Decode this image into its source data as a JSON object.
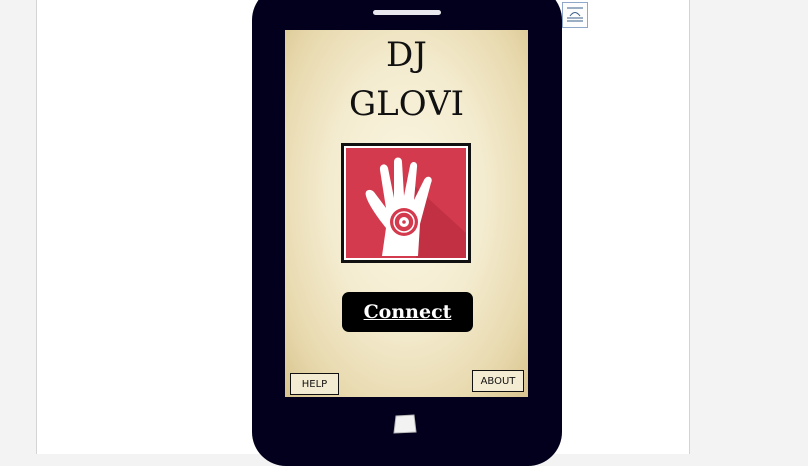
{
  "app": {
    "title_line1": "DJ",
    "title_line2": "GLOVI"
  },
  "buttons": {
    "connect_label": "Connect",
    "help_label": "HELP",
    "about_label": "ABOUT"
  },
  "icons": {
    "logo": "hand-vinyl-record-icon",
    "layout_options": "layout-options-icon",
    "home": "home-button-icon"
  },
  "colors": {
    "phone": "#02001c",
    "logo_background": "#d43a4d",
    "button": "#000000",
    "screen": "#f4ecd0"
  }
}
